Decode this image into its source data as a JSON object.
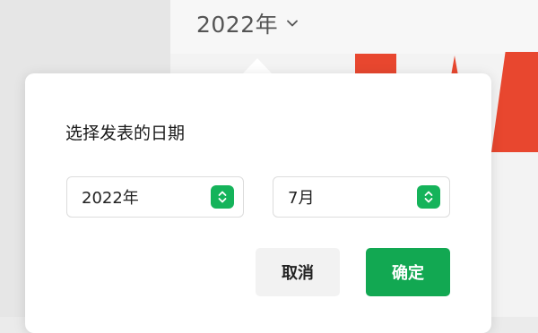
{
  "header": {
    "year_label": "2022年",
    "chevron_icon": "chevron-down-icon"
  },
  "popover": {
    "title": "选择发表的日期",
    "year_select": {
      "value": "2022年",
      "icon": "stepper-updown-icon"
    },
    "month_select": {
      "value": "7月",
      "icon": "stepper-updown-icon"
    },
    "cancel_label": "取消",
    "confirm_label": "确定"
  },
  "colors": {
    "accent_green": "#12a852",
    "background_red": "#e8472f"
  }
}
